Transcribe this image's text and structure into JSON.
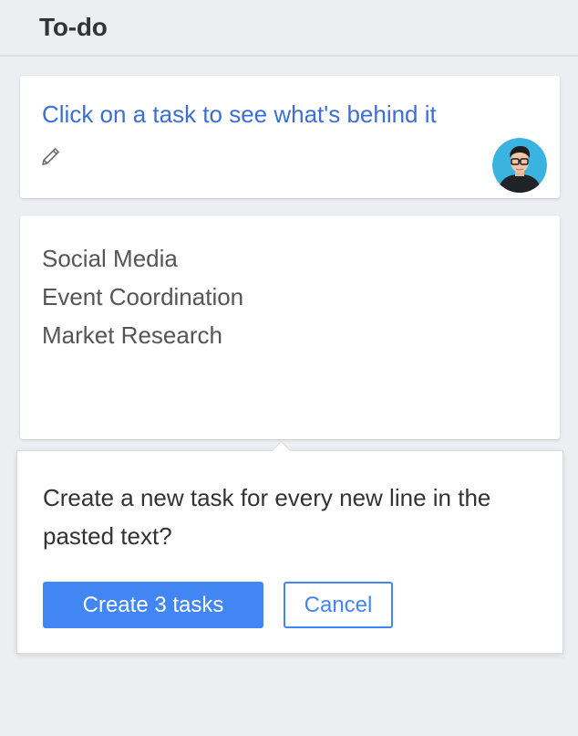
{
  "header": {
    "title": "To-do"
  },
  "task_card": {
    "title": "Click on a task to see what's behind it",
    "edit_icon": "pencil-icon",
    "avatar": "user-avatar"
  },
  "pasted_text": {
    "lines": [
      "Social Media",
      "Event Coordination",
      "Market Research"
    ]
  },
  "popover": {
    "message": "Create a new task for every new line in the pasted text?",
    "confirm_label": "Create 3 tasks",
    "cancel_label": "Cancel"
  },
  "colors": {
    "accent": "#4286f4",
    "link": "#3b6fd1",
    "background": "#eceef1"
  }
}
